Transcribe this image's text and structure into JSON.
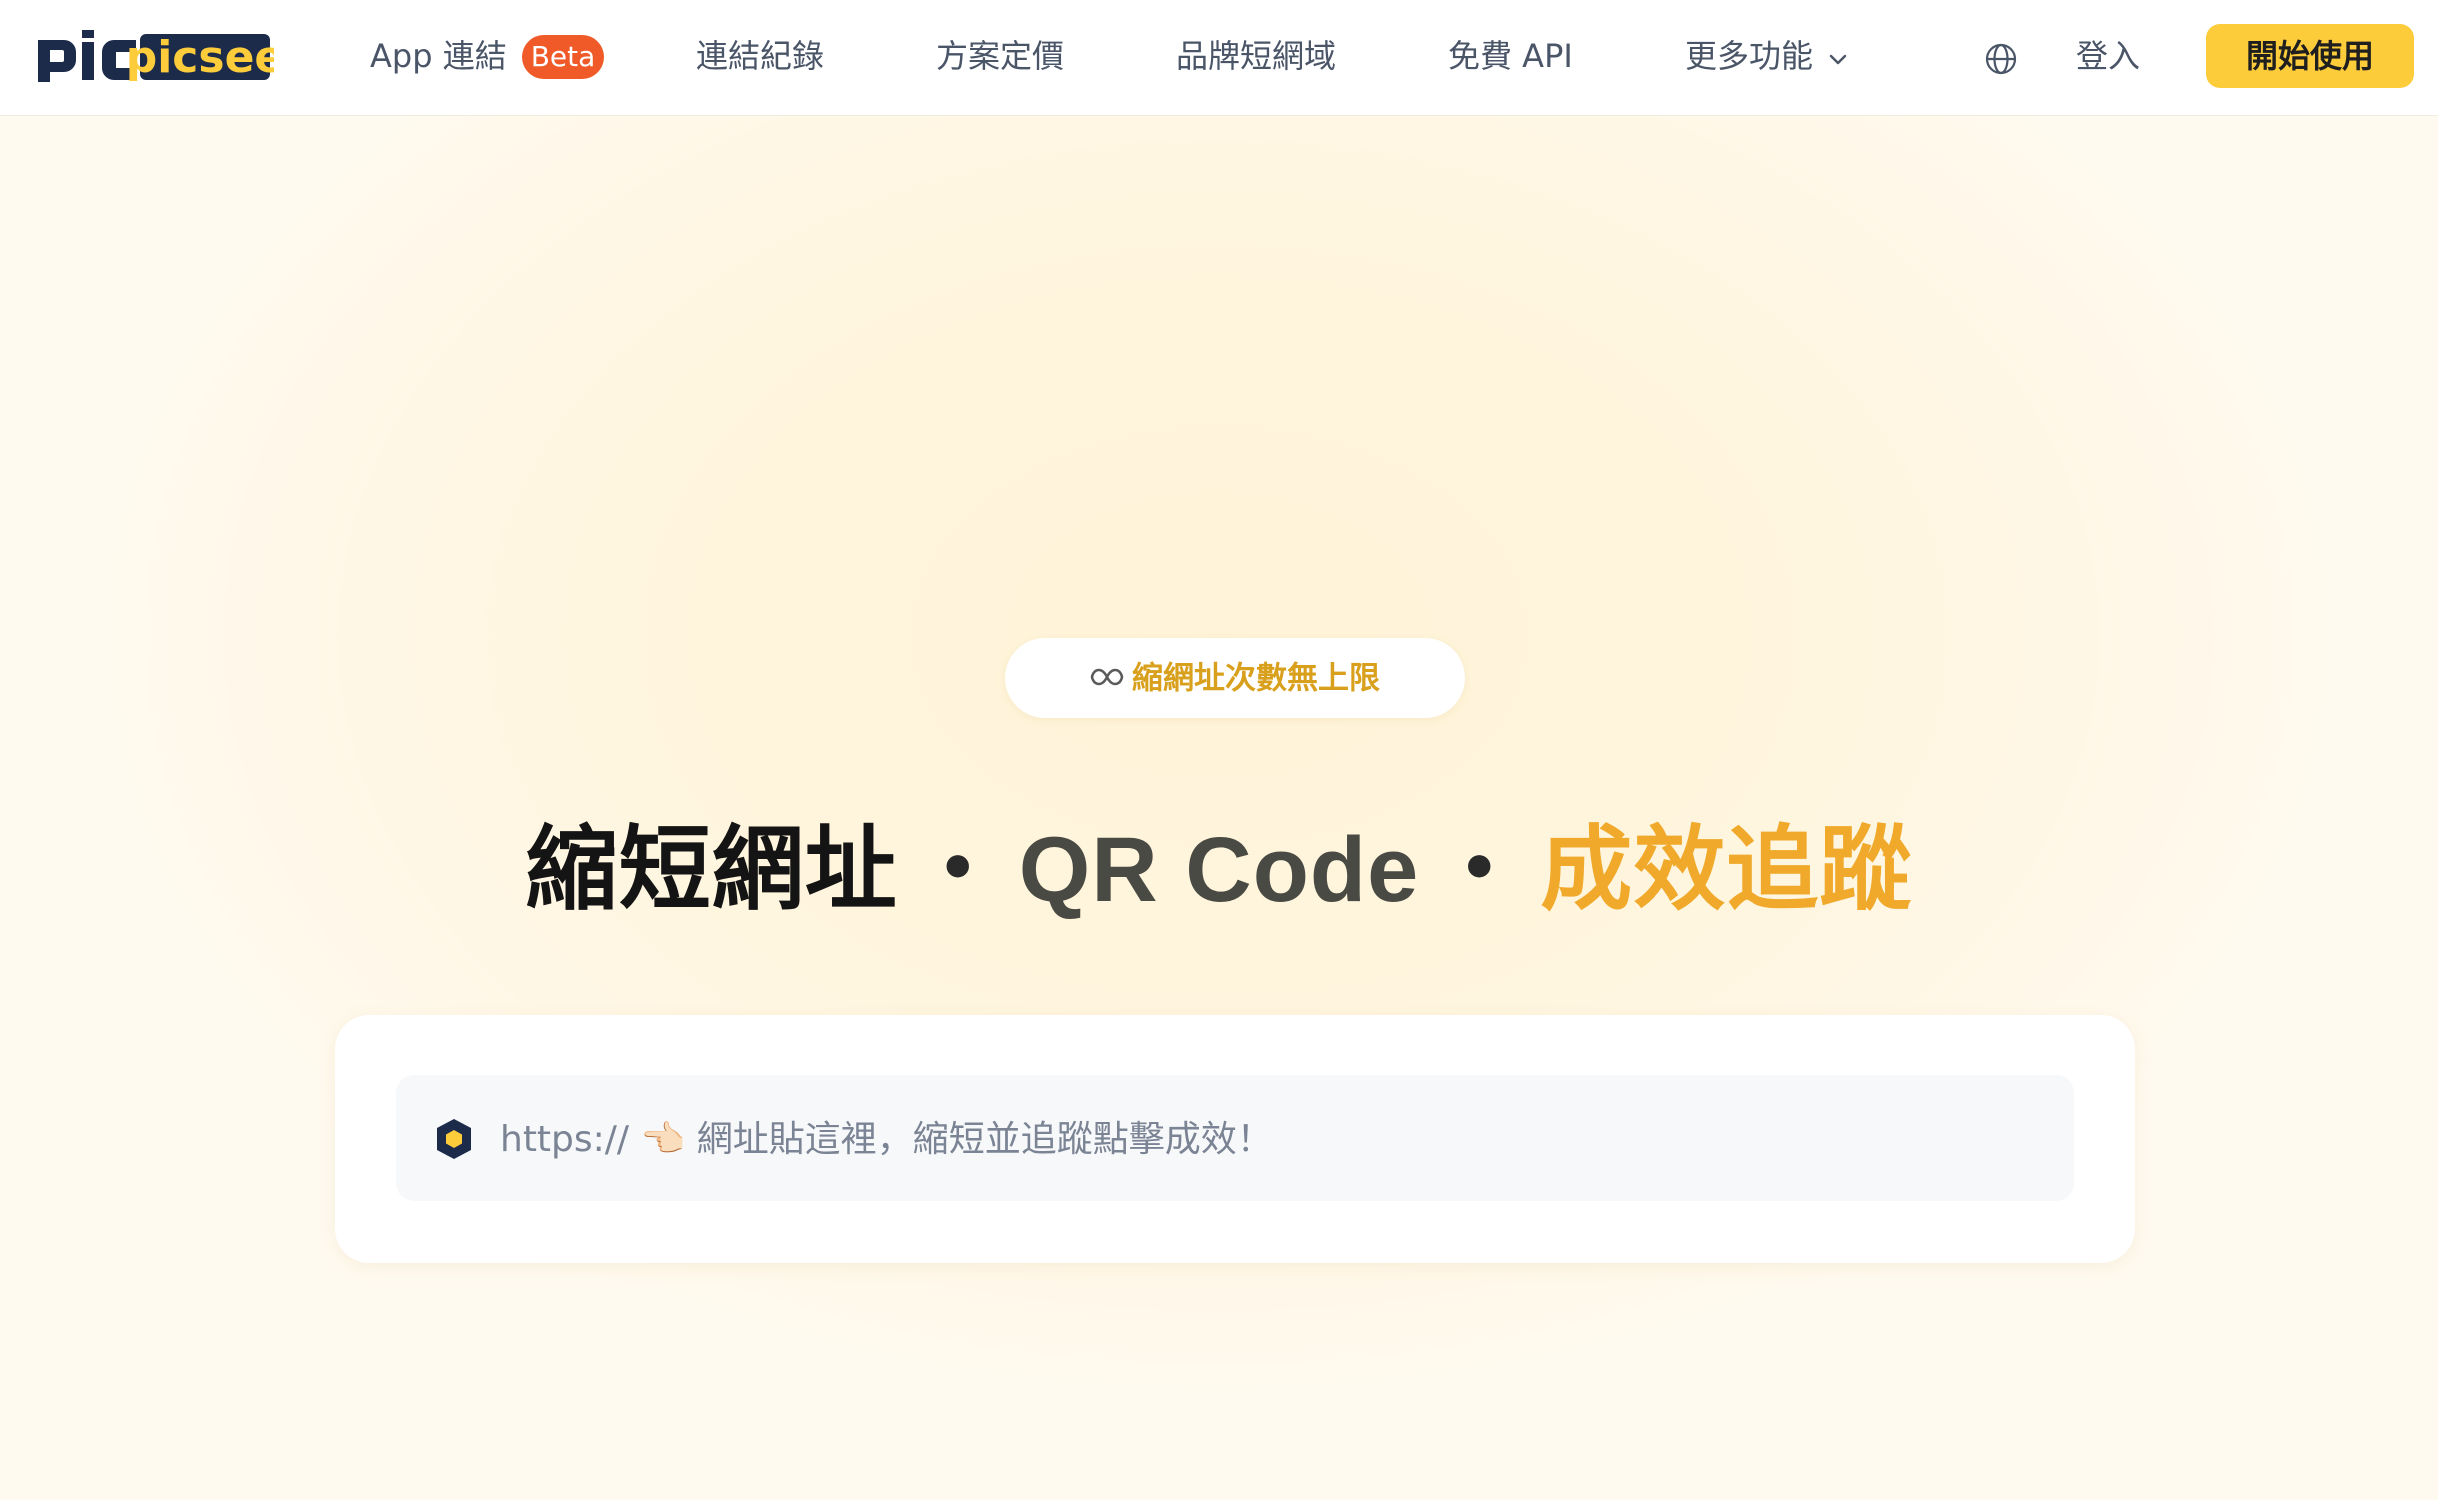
{
  "header": {
    "logo_text": "picsee",
    "nav": [
      {
        "label": "App 連結"
      },
      {
        "label": "連結紀錄"
      },
      {
        "label": "方案定價"
      },
      {
        "label": "品牌短網域"
      },
      {
        "label": "免費 API"
      },
      {
        "label": "更多功能"
      }
    ],
    "beta_badge": "Beta",
    "login_label": "登入",
    "start_label": "開始使用"
  },
  "hero": {
    "pill_text": "縮網址次數無上限",
    "headline_part1": "縮短網址",
    "separator": "・",
    "headline_part2": "QR Code",
    "headline_part3": "成效追蹤"
  },
  "shortener": {
    "placeholder": "https:// 👈🏻 網址貼這裡，縮短並追蹤點擊成效！",
    "value": ""
  },
  "colors": {
    "accent": "#fdcc3a",
    "badge": "#f05a28",
    "highlight": "#f0a92a",
    "brand_navy": "#1c2b4a"
  }
}
